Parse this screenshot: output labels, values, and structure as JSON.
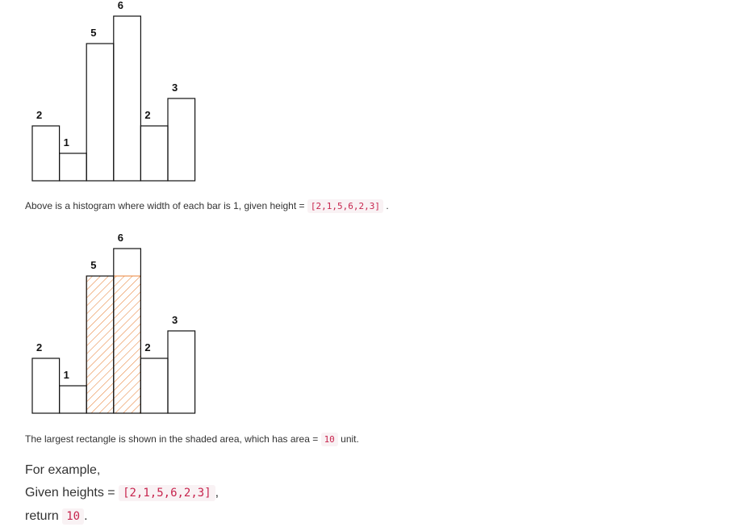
{
  "chart_data": [
    {
      "type": "bar",
      "categories": [
        "",
        "",
        "",
        "",
        "",
        ""
      ],
      "values": [
        2,
        1,
        5,
        6,
        2,
        3
      ],
      "data_labels": [
        "2",
        "1",
        "5",
        "6",
        "2",
        "3"
      ],
      "ylim": [
        0,
        6
      ],
      "grid": false,
      "bar_color": "#ffffff",
      "outline_color": "#111111"
    },
    {
      "type": "bar",
      "categories": [
        "",
        "",
        "",
        "",
        "",
        ""
      ],
      "values": [
        2,
        1,
        5,
        6,
        2,
        3
      ],
      "data_labels": [
        "2",
        "1",
        "5",
        "6",
        "2",
        "3"
      ],
      "ylim": [
        0,
        6
      ],
      "grid": false,
      "bar_color": "#ffffff",
      "outline_color": "#111111",
      "shaded_region": {
        "bar_start": 2,
        "bar_end": 3,
        "height": 5,
        "color": "#e8833a",
        "pattern": "diagonal-hatch"
      }
    }
  ],
  "caption1": {
    "before": "Above is a histogram where width of each bar is 1, given height = ",
    "code": "[2,1,5,6,2,3]",
    "after": "."
  },
  "caption2": {
    "before": "The largest rectangle is shown in the shaded area, which has area = ",
    "code": "10",
    "after": "unit."
  },
  "example": {
    "intro": "For example,",
    "given_prefix": "Given heights = ",
    "given_code": "[2,1,5,6,2,3]",
    "given_suffix": ",",
    "return_prefix": "return",
    "return_code": "10",
    "return_suffix": "."
  },
  "colors": {
    "text": "#333333",
    "code_text": "#c7254e",
    "code_bg": "#f9f2f4",
    "hatch": "#e8833a"
  }
}
